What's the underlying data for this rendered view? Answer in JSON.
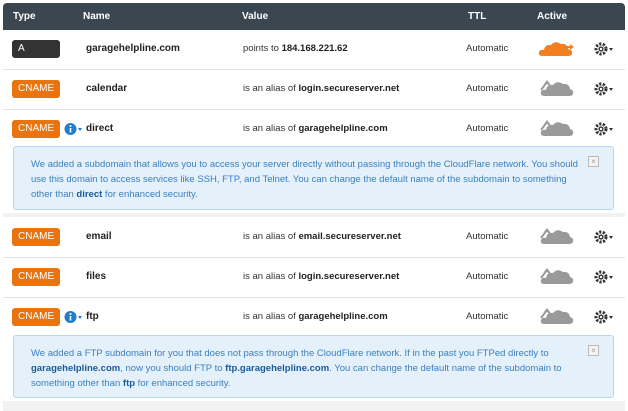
{
  "header": {
    "type": "Type",
    "name": "Name",
    "value": "Value",
    "ttl": "TTL",
    "active": "Active"
  },
  "records": [
    {
      "type": "A",
      "name": "garagehelpline.com",
      "value_prefix": "points to",
      "value_target": "184.168.221.62",
      "ttl": "Automatic",
      "active": true
    },
    {
      "type": "CNAME",
      "name": "calendar",
      "value_prefix": "is an alias of",
      "value_target": "login.secureserver.net",
      "ttl": "Automatic",
      "active": false
    },
    {
      "type": "CNAME",
      "name": "direct",
      "value_prefix": "is an alias of",
      "value_target": "garagehelpline.com",
      "ttl": "Automatic",
      "active": false
    },
    {
      "type": "CNAME",
      "name": "email",
      "value_prefix": "is an alias of",
      "value_target": "email.secureserver.net",
      "ttl": "Automatic",
      "active": false
    },
    {
      "type": "CNAME",
      "name": "files",
      "value_prefix": "is an alias of",
      "value_target": "login.secureserver.net",
      "ttl": "Automatic",
      "active": false
    },
    {
      "type": "CNAME",
      "name": "ftp",
      "value_prefix": "is an alias of",
      "value_target": "garagehelpline.com",
      "ttl": "Automatic",
      "active": false
    }
  ],
  "notes": {
    "direct": {
      "t1": "We added a subdomain that allows you to access your server directly without passing through the CloudFlare network. You should use this domain to access services like SSH, FTP, and Telnet. You can change the default name of the subdomain to something other than ",
      "b1": "direct",
      "t2": " for enhanced security."
    },
    "ftp": {
      "t1": "We added a FTP subdomain for you that does not pass through the CloudFlare network. If in the past you FTPed directly to ",
      "b1": "garagehelpline.com",
      "t2": ", now you should FTP to ",
      "b2": "ftp.garagehelpline.com",
      "t3": ". You can change the default name of the subdomain to something other than ",
      "b3": "ftp",
      "t4": " for enhanced security."
    }
  },
  "colors": {
    "header_bg": "#3a4650",
    "cname_badge": "#e8730f",
    "a_badge": "#333333",
    "cloud_active": "#f38020",
    "cloud_inactive": "#9a9a9a",
    "note_bg": "#e4f1fb",
    "info_icon": "#1f7ecf"
  },
  "icons": {
    "active_cloud": "cloud-on-icon",
    "inactive_cloud": "cloud-off-icon",
    "settings": "gear-icon",
    "info": "info-icon",
    "close": "close-icon"
  }
}
